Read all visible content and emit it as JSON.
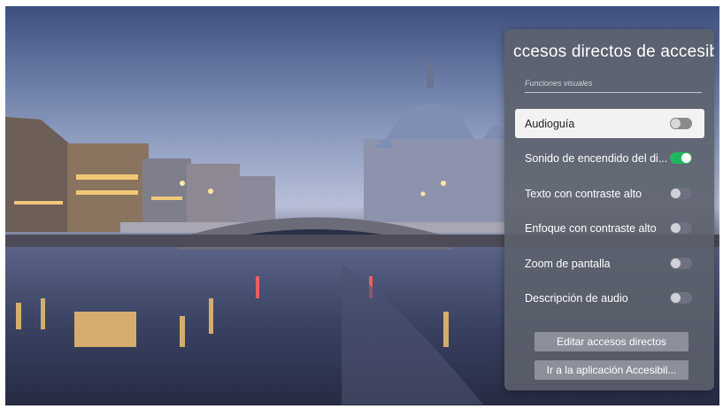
{
  "panel": {
    "title": "ccesos directos de accesibil",
    "section_label": "Funciones visuales"
  },
  "items": [
    {
      "label": "Audioguía",
      "on": false,
      "focused": true
    },
    {
      "label": "Sonido de encendido del di...",
      "on": true,
      "focused": false
    },
    {
      "label": "Texto con contraste alto",
      "on": false,
      "focused": false
    },
    {
      "label": "Enfoque con contraste alto",
      "on": false,
      "focused": false
    },
    {
      "label": "Zoom de pantalla",
      "on": false,
      "focused": false
    },
    {
      "label": "Descripción de audio",
      "on": false,
      "focused": false
    }
  ],
  "buttons": {
    "edit": "Editar accesos directos",
    "open_app": "Ir a la aplicación Accesibil..."
  },
  "colors": {
    "toggle_on": "#1fb860",
    "panel_bg": "#5c606c"
  }
}
